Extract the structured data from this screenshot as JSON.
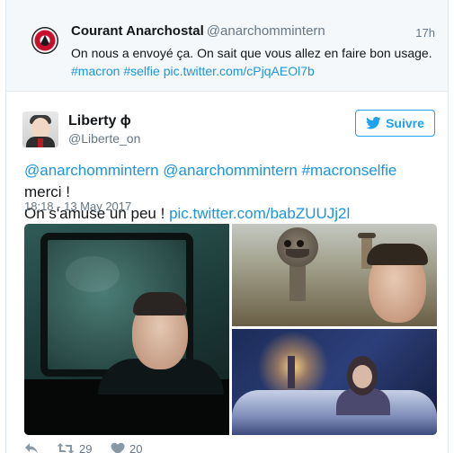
{
  "parent_tweet": {
    "name": "Courant Anarchostal",
    "handle": "@anarchommintern",
    "time": "17h",
    "text": "On nous a envoyé ça. On sait que vous allez en faire bon usage.",
    "hashtags": "#macron #selfie",
    "link": "pic.twitter.com/cPjqAEOl7b"
  },
  "main_tweet": {
    "name": "Liberty ϕ",
    "handle": "@Liberte_on",
    "follow_label": "Suivre",
    "mention1": "@anarchommintern",
    "mention2": "@anarchommintern",
    "hashtag": "#macronselfie",
    "text_mid": " merci !",
    "text_line2": "On s'amuse un peu ! ",
    "link": "pic.twitter.com/babZUUJj2l",
    "timestamp": "18:18 - 13 May 2017"
  },
  "actions": {
    "retweets": "29",
    "likes": "20"
  },
  "colors": {
    "accent": "#1da1f2",
    "link": "#1b95e0",
    "muted": "#657786"
  },
  "icons": {
    "reply": "reply-icon",
    "retweet": "retweet-icon",
    "like": "heart-icon",
    "follow": "bird-icon"
  }
}
